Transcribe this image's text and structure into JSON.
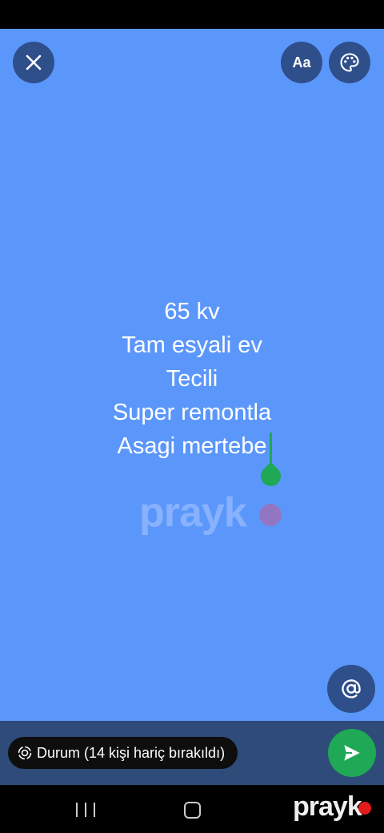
{
  "toolbar": {
    "font_label": "Aa"
  },
  "status": {
    "lines": [
      "65 kv",
      "Tam esyali ev",
      "Tecili",
      "Super remontla",
      "Asagi mertebe"
    ]
  },
  "audience": {
    "label": "Durum (14 kişi hariç bırakıldı)"
  },
  "watermark": {
    "text": "prayk"
  },
  "brand": {
    "text": "prayk"
  },
  "colors": {
    "canvas": "#5b97fb",
    "accent": "#1fa855",
    "bottom_bar": "#2e4b79"
  },
  "icons": [
    "close-icon",
    "palette-icon",
    "at-sign-icon",
    "status-ring-icon",
    "send-icon"
  ]
}
